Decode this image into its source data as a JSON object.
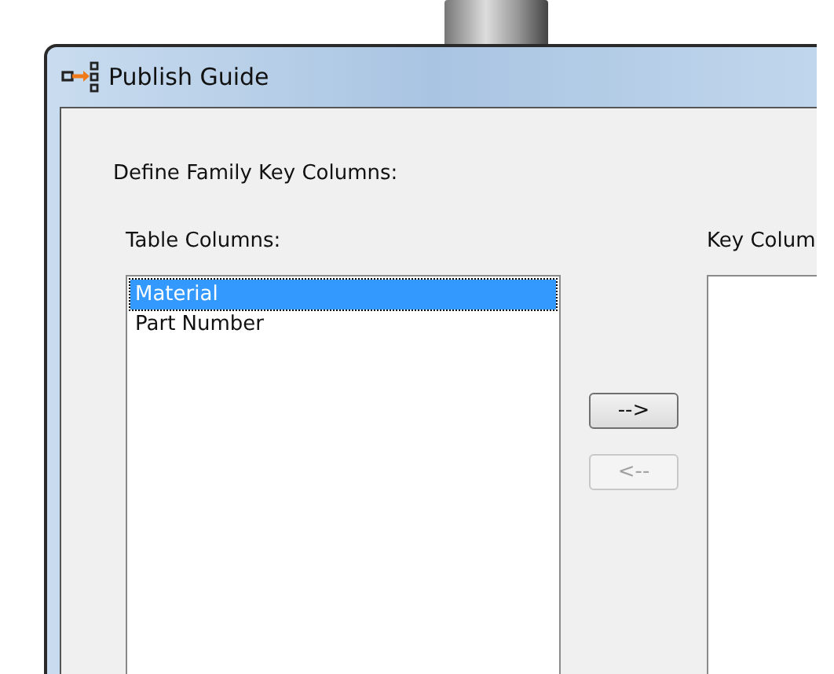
{
  "window": {
    "title": "Publish Guide"
  },
  "heading": "Define Family Key Columns:",
  "table_columns": {
    "label": "Table Columns:",
    "items": [
      {
        "text": "Material",
        "selected": true
      },
      {
        "text": "Part Number",
        "selected": false
      }
    ]
  },
  "buttons": [
    {
      "label": "-->",
      "disabled": false
    },
    {
      "label": "<--",
      "disabled": true
    }
  ],
  "key_columns": {
    "label": "Key Colum"
  }
}
